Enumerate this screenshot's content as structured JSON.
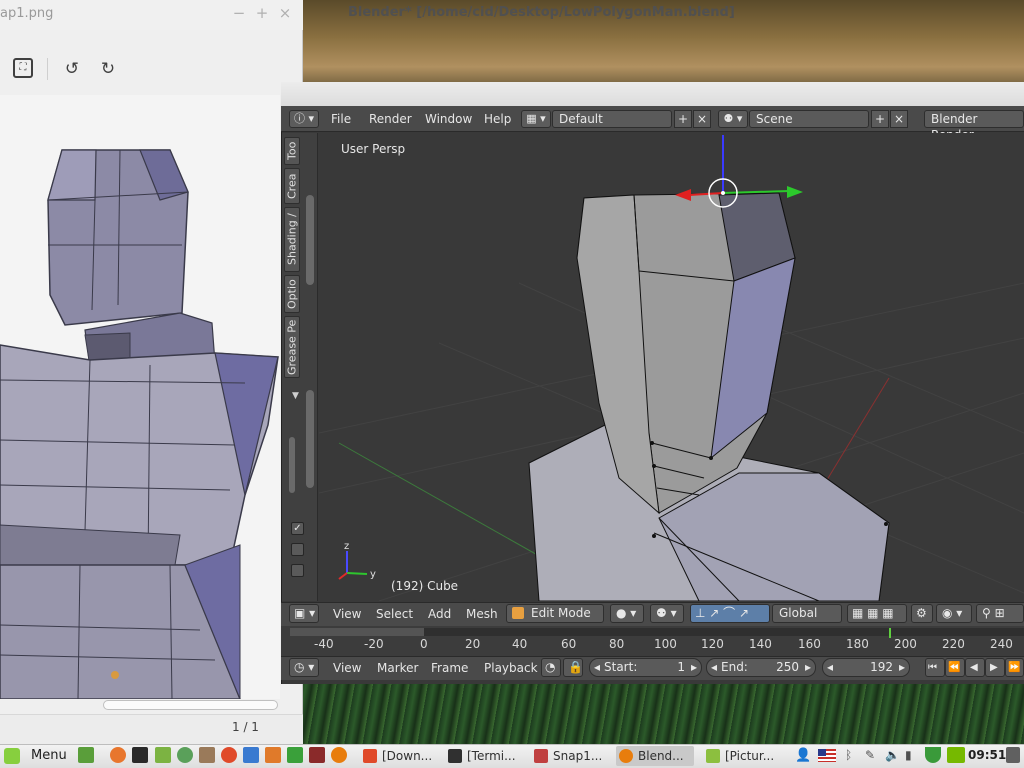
{
  "viewer": {
    "title": "ap1.png",
    "page_indicator": "1 / 1"
  },
  "blender": {
    "title": "Blender* [/home/cid/Desktop/LowPolygonMan.blend]",
    "menu": [
      "File",
      "Render",
      "Window",
      "Help"
    ],
    "layout": "Default",
    "scene": "Scene",
    "engine": "Blender Render",
    "shelf_tabs": [
      "Too",
      "Crea",
      "Shading /",
      "Optio",
      "Grease Pe"
    ],
    "viewport_label": "User Persp",
    "object_label": "(192) Cube",
    "header_menu": [
      "View",
      "Select",
      "Add",
      "Mesh"
    ],
    "mode": "Edit Mode",
    "orientation": "Global",
    "timeline_ticks": [
      "-40",
      "-20",
      "0",
      "20",
      "40",
      "60",
      "80",
      "100",
      "120",
      "140",
      "160",
      "180",
      "200",
      "220",
      "240"
    ],
    "timeline_menu": [
      "View",
      "Marker",
      "Frame",
      "Playback"
    ],
    "start_label": "Start:",
    "start_value": "1",
    "end_label": "End:",
    "end_value": "250",
    "current_frame": "192"
  },
  "taskbar": {
    "menu_label": "Menu",
    "apps": [
      {
        "label": "[Down...",
        "color": "#e04a2a"
      },
      {
        "label": "[Termi...",
        "color": "#303030"
      },
      {
        "label": "Snap1...",
        "color": "#c04040"
      },
      {
        "label": "Blend...",
        "color": "#e87d0d"
      },
      {
        "label": "[Pictur...",
        "color": "#8cbf3f"
      }
    ],
    "clock": "09:51"
  },
  "colors": {
    "blender_bg": "#393939",
    "accent_green": "#5fcf3f",
    "mint_green": "#87cf3e"
  }
}
